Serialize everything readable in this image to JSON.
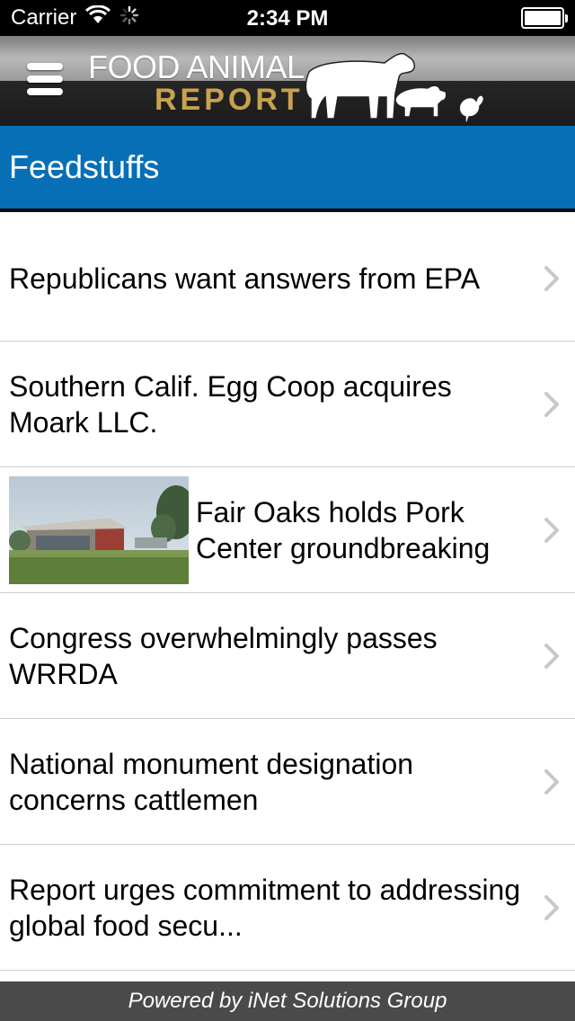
{
  "status_bar": {
    "carrier": "Carrier",
    "time": "2:34 PM"
  },
  "header": {
    "logo_line1": "FOOD ANIMAL",
    "logo_line2": "REPORT",
    "logo_accent_color": "#c9a24f"
  },
  "section": {
    "title": "Feedstuffs",
    "color": "#066fb5"
  },
  "articles": [
    {
      "title": "Republicans want answers from EPA",
      "has_thumbnail": false
    },
    {
      "title": "Southern Calif. Egg Coop acquires Moark LLC.",
      "has_thumbnail": false
    },
    {
      "title": "Fair Oaks holds Pork Center groundbreaking",
      "has_thumbnail": true
    },
    {
      "title": "Congress overwhelmingly passes WRRDA",
      "has_thumbnail": false
    },
    {
      "title": "National monument designation concerns cattlemen",
      "has_thumbnail": false
    },
    {
      "title": "Report urges commitment to addressing global food secu...",
      "has_thumbnail": false
    }
  ],
  "footer": {
    "text": "Powered by iNet Solutions Group"
  },
  "icons": [
    "wifi-icon",
    "activity-spinner-icon",
    "battery-icon",
    "menu-icon",
    "chevron-right-icon",
    "cow-icon",
    "pig-icon",
    "chicken-icon"
  ]
}
